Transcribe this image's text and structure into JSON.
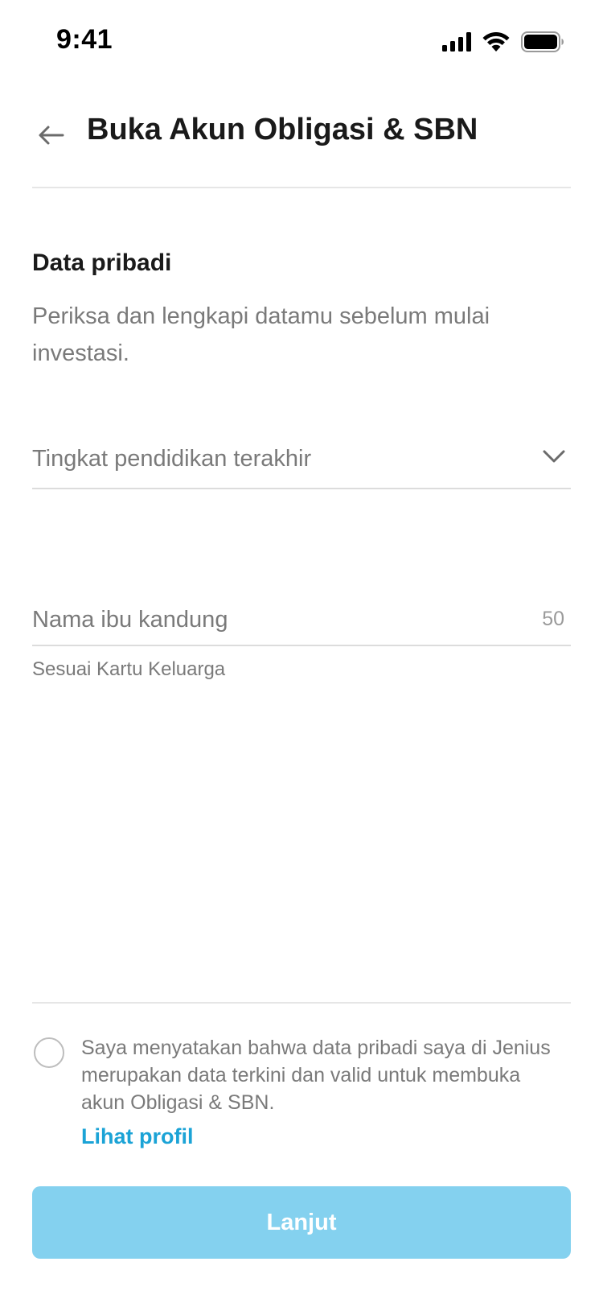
{
  "status_bar": {
    "time": "9:41",
    "icons": [
      "cellular-signal-icon",
      "wifi-icon",
      "battery-icon"
    ]
  },
  "header": {
    "back_icon": "arrow-left-icon",
    "title": "Buka Akun Obligasi & SBN"
  },
  "section": {
    "title": "Data pribadi",
    "description": "Periksa dan lengkapi datamu sebelum mulai investasi."
  },
  "form": {
    "education": {
      "placeholder": "Tingkat pendidikan terakhir",
      "value": "",
      "icon": "chevron-down-icon"
    },
    "mother_name": {
      "placeholder": "Nama ibu kandung",
      "value": "",
      "char_limit": "50",
      "helper": "Sesuai Kartu Keluarga"
    }
  },
  "consent": {
    "checked": false,
    "text": "Saya menyatakan bahwa data pribadi saya di Jenius merupakan data terkini dan valid untuk membuka akun Obligasi & SBN.",
    "link_label": "Lihat profil"
  },
  "footer": {
    "button_label": "Lanjut"
  },
  "colors": {
    "accent": "#1ba3d6",
    "button_disabled": "#84d1ef",
    "text_primary": "#1a1a1a",
    "text_secondary": "#7a7a7a",
    "divider": "#e6e6e6"
  }
}
